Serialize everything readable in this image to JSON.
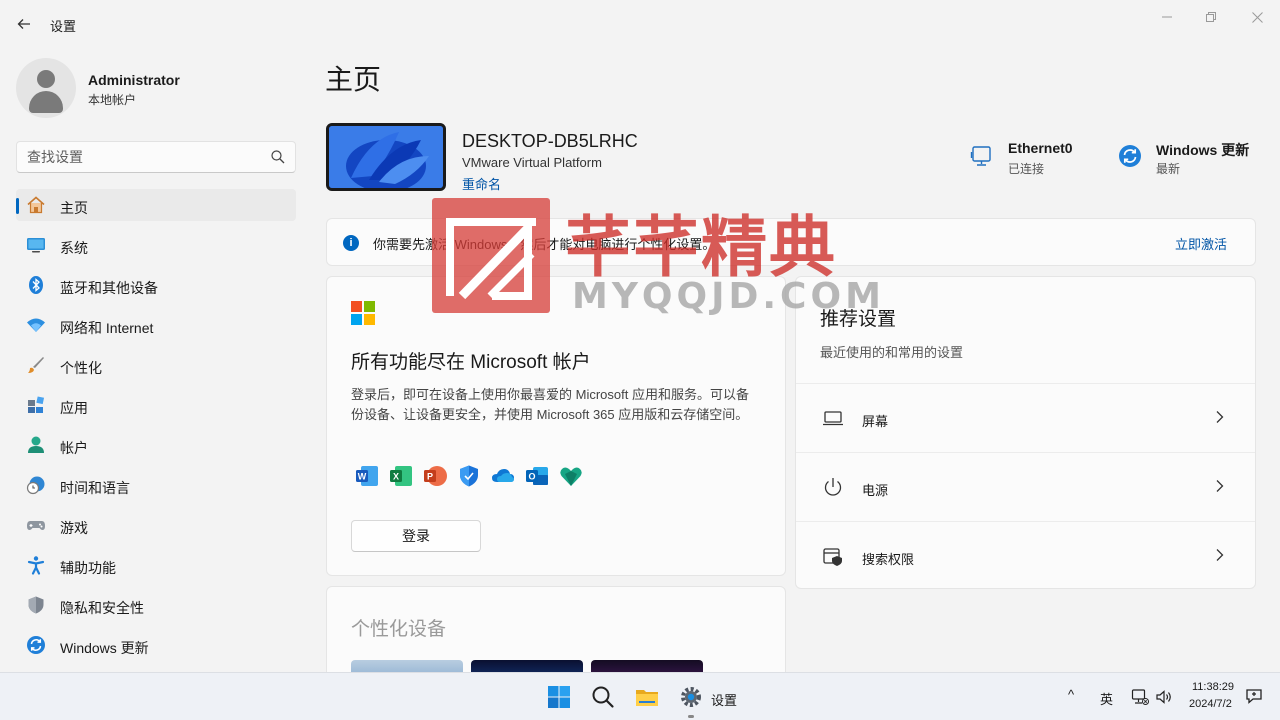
{
  "window": {
    "title": "设置",
    "back_icon": "arrow-left-icon",
    "controls": [
      "minimize-icon",
      "restore-icon",
      "close-icon"
    ]
  },
  "user": {
    "name": "Administrator",
    "account_type": "本地帐户"
  },
  "search": {
    "placeholder": "查找设置",
    "icon": "search-icon"
  },
  "nav": {
    "items": [
      {
        "label": "主页",
        "icon": "home-icon",
        "active": true
      },
      {
        "label": "系统",
        "icon": "monitor-icon"
      },
      {
        "label": "蓝牙和其他设备",
        "icon": "bluetooth-icon"
      },
      {
        "label": "网络和 Internet",
        "icon": "wifi-icon"
      },
      {
        "label": "个性化",
        "icon": "brush-icon"
      },
      {
        "label": "应用",
        "icon": "apps-icon"
      },
      {
        "label": "帐户",
        "icon": "person-icon"
      },
      {
        "label": "时间和语言",
        "icon": "clock-globe-icon"
      },
      {
        "label": "游戏",
        "icon": "gamepad-icon"
      },
      {
        "label": "辅助功能",
        "icon": "accessibility-icon"
      },
      {
        "label": "隐私和安全性",
        "icon": "shield-icon"
      },
      {
        "label": "Windows 更新",
        "icon": "update-icon"
      }
    ]
  },
  "main": {
    "title": "主页",
    "device": {
      "name": "DESKTOP-DB5LRHC",
      "model": "VMware Virtual Platform",
      "rename_label": "重命名",
      "thumbnail_icon": "windows-bloom-wallpaper"
    },
    "status": {
      "network": {
        "title": "Ethernet0",
        "subtitle": "已连接",
        "icon": "ethernet-icon"
      },
      "update": {
        "title": "Windows 更新",
        "subtitle": "最新",
        "icon": "update-icon"
      }
    },
    "activation": {
      "message": "你需要先激活 Windows，然后才能对电脑进行个性化设置。",
      "action": "立即激活",
      "icon": "info-icon"
    },
    "microsoft_card": {
      "logo": "microsoft-logo",
      "title": "所有功能尽在 Microsoft 帐户",
      "description": "登录后，即可在设备上使用你最喜爱的 Microsoft 应用和服务。可以备份设备、让设备更安全，并使用 Microsoft 365 应用版和云存储空间。",
      "apps": [
        "word-icon",
        "excel-icon",
        "powerpoint-icon",
        "defender-icon",
        "onedrive-icon",
        "outlook-icon",
        "family-safety-icon"
      ],
      "signin_label": "登录"
    },
    "recommended": {
      "title": "推荐设置",
      "subtitle": "最近使用的和常用的设置",
      "items": [
        {
          "label": "屏幕",
          "icon": "laptop-icon"
        },
        {
          "label": "电源",
          "icon": "power-icon"
        },
        {
          "label": "搜索权限",
          "icon": "search-permission-icon"
        }
      ]
    },
    "personalize": {
      "title": "个性化设备"
    }
  },
  "watermark": {
    "text": "芊芊精典",
    "url": "MYQQJD.COM"
  },
  "taskbar": {
    "apps": [
      "start-icon",
      "search-icon",
      "file-explorer-icon",
      "settings-gear-icon"
    ],
    "active_label": "设置",
    "tray": {
      "chevron": "^",
      "ime": "英",
      "network_icon": "network-icon",
      "volume_icon": "volume-icon",
      "notification_icon": "notification-icon"
    },
    "time": "11:38:29",
    "date": "2024/7/2"
  },
  "colors": {
    "accent": "#0067c0",
    "link": "#0054a6",
    "watermark_red": "#d53c37"
  }
}
